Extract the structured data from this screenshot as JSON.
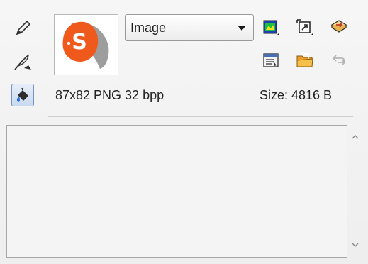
{
  "tools": [
    {
      "name": "pencil-icon"
    },
    {
      "name": "feather-pen-icon"
    },
    {
      "name": "fill-bucket-icon",
      "active": true
    }
  ],
  "thumbnail": {
    "icon": "sketchup-logo-icon"
  },
  "format_select": {
    "selected": "Image"
  },
  "info": {
    "dimensions": "87x82 PNG 32 bpp",
    "size": "Size: 4816 B"
  },
  "colors": {
    "accent_orange": "#ef5a1c",
    "active_tool_border": "#7a95bd"
  }
}
